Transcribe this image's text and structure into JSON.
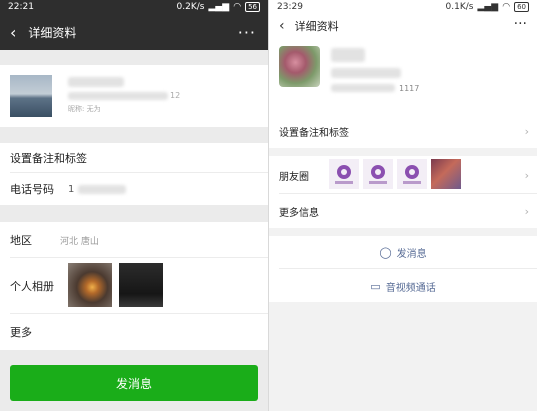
{
  "left": {
    "status": {
      "time": "22:21",
      "speed": "0.2K/s",
      "battery": "56"
    },
    "title": "详细资料",
    "more": "···",
    "profile": {
      "nickname": "昵称: 无为",
      "number_fragment": "12"
    },
    "rows": {
      "remark": "设置备注和标签",
      "phone_label": "电话号码",
      "phone_value": "1",
      "region_label": "地区",
      "region_value": "河北  唐山",
      "album_label": "个人相册",
      "more_label": "更多"
    },
    "send_button": "发消息"
  },
  "right": {
    "status": {
      "time": "23:29",
      "speed": "0.1K/s",
      "battery": "60"
    },
    "title": "详细资料",
    "more": "···",
    "profile": {
      "number_fragment": "1117"
    },
    "rows": {
      "remark": "设置备注和标签",
      "moments": "朋友圈",
      "more_info": "更多信息"
    },
    "actions": {
      "send_message": "发消息",
      "video_call": "音视频通话"
    }
  },
  "colors": {
    "wechat_green": "#1aad19",
    "link_blue": "#576b95",
    "dark_header": "#2e2e2e"
  }
}
